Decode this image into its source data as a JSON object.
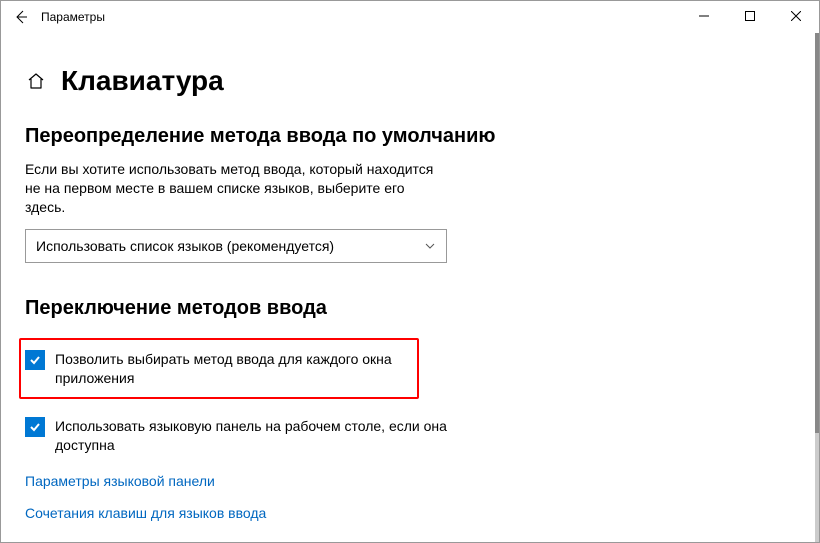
{
  "window": {
    "title": "Параметры"
  },
  "page": {
    "title": "Клавиатура"
  },
  "section1": {
    "title": "Переопределение метода ввода по умолчанию",
    "desc": "Если вы хотите использовать метод ввода, который находится не на первом месте в вашем списке языков, выберите его здесь.",
    "dropdown_value": "Использовать список языков (рекомендуется)"
  },
  "section2": {
    "title": "Переключение методов ввода",
    "opt1_label": "Позволить выбирать метод ввода для каждого окна приложения",
    "opt2_label": "Использовать языковую панель на рабочем столе, если она доступна"
  },
  "links": {
    "lang_panel": "Параметры языковой панели",
    "hotkeys": "Сочетания клавиш для языков ввода"
  }
}
